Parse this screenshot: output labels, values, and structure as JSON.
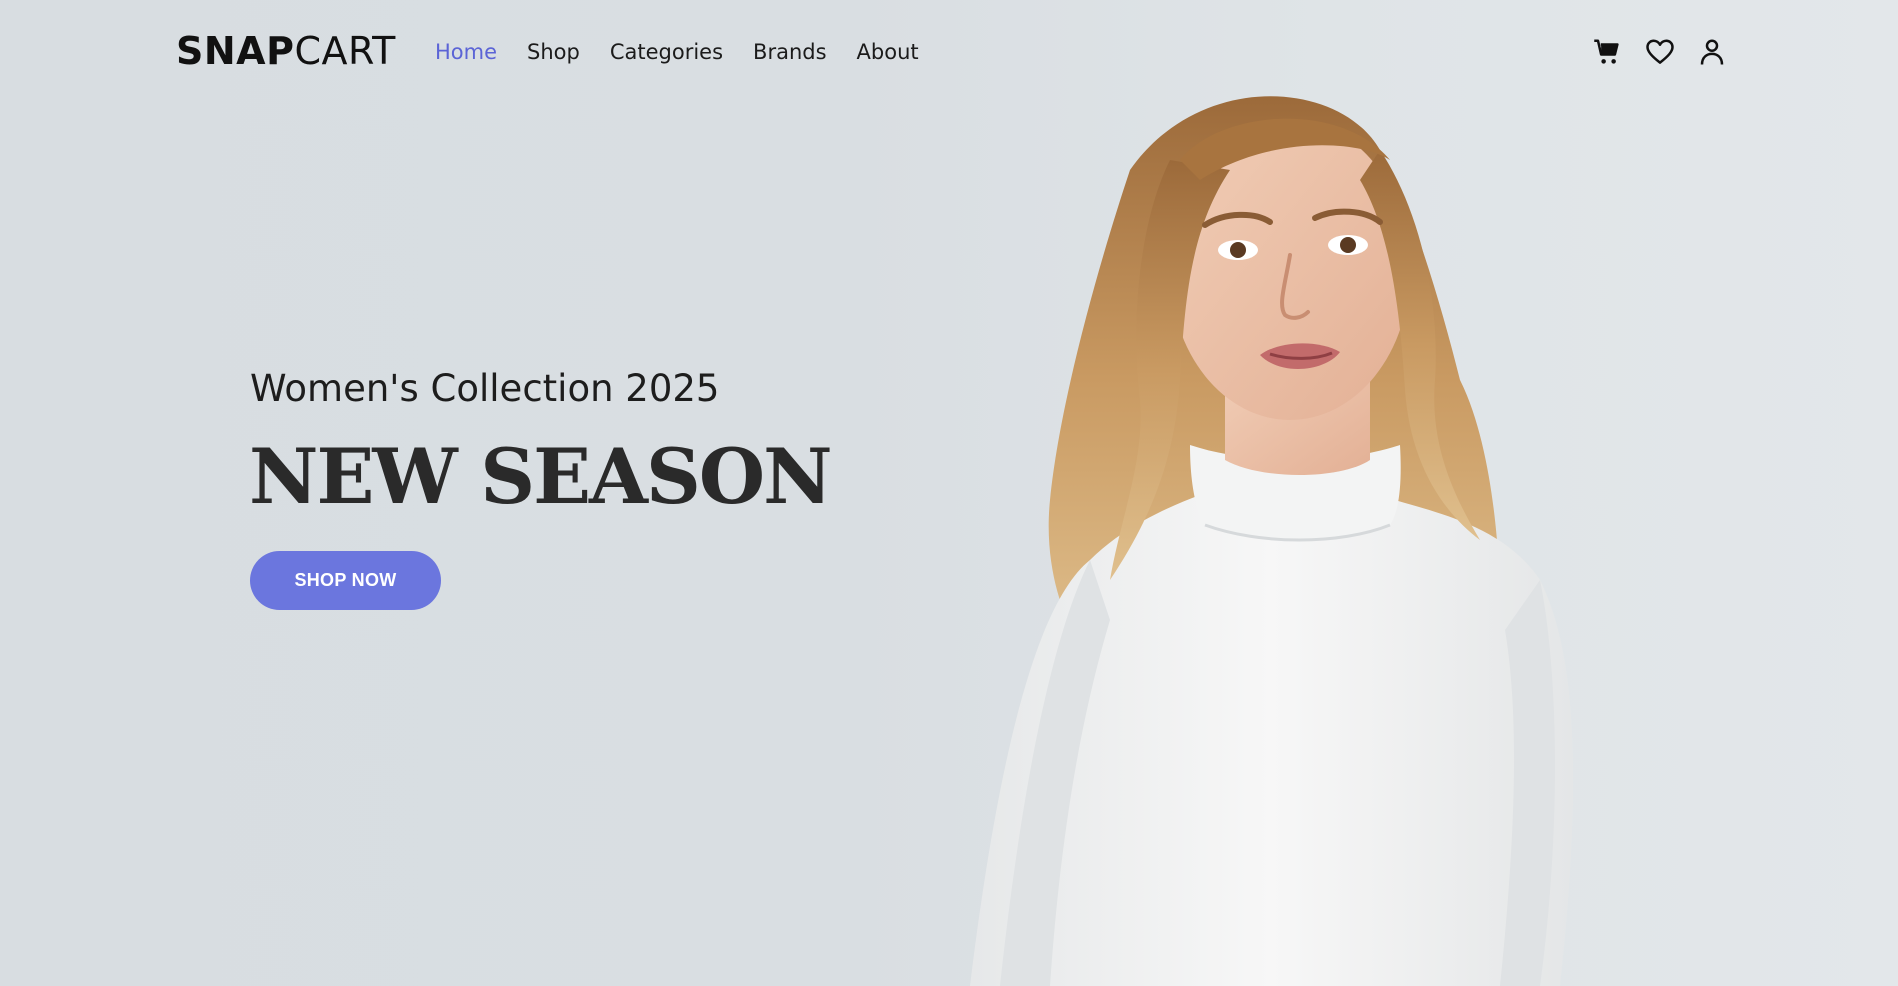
{
  "header": {
    "logo_bold": "SNAP",
    "logo_light": "CART",
    "nav": [
      {
        "label": "Home",
        "active": true
      },
      {
        "label": "Shop",
        "active": false
      },
      {
        "label": "Categories",
        "active": false
      },
      {
        "label": "Brands",
        "active": false
      },
      {
        "label": "About",
        "active": false
      }
    ],
    "icons": [
      "cart-icon",
      "heart-icon",
      "user-icon"
    ]
  },
  "hero": {
    "subtitle": "Women's Collection 2025",
    "headline": "NEW SEASON",
    "cta_label": "SHOP NOW"
  },
  "colors": {
    "accent": "#5b64d6",
    "button": "#6b76de",
    "background": "#d9dee2",
    "text": "#1d1d1d"
  }
}
